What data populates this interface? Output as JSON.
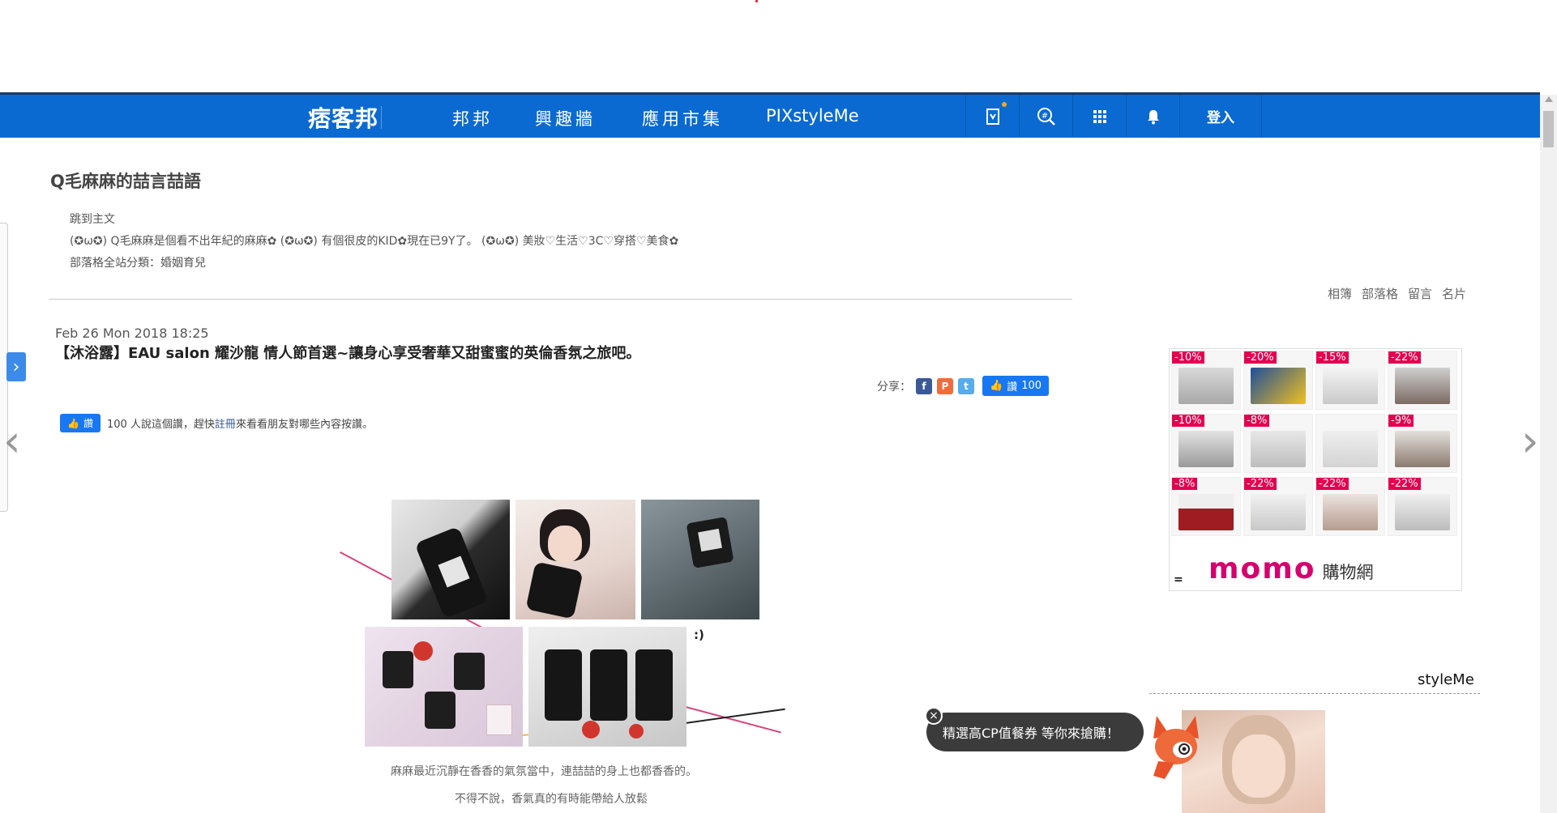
{
  "nav": {
    "logo": "痞客邦",
    "items": [
      "邦邦",
      "興趣牆",
      "應用市集",
      "PIXstyleMe"
    ],
    "login": "登入",
    "icons": [
      "bookmark-icon",
      "search-hash-icon",
      "apps-grid-icon",
      "bell-icon"
    ]
  },
  "blog": {
    "title": "Q毛麻麻的喆言喆語",
    "skip_link": "跳到主文",
    "description": "(✪ω✪) Q毛麻麻是個看不出年紀的麻麻✿ (✪ω✪) 有個很皮的KID✿現在已9Y了。 (✪ω✪) 美妝♡生活♡3C♡穿搭♡美食✿",
    "category": "部落格全站分類：婚姻育兒"
  },
  "side_links": [
    "相簿",
    "部落格",
    "留言",
    "名片"
  ],
  "post": {
    "date": "Feb 26 Mon 2018 18:25",
    "title": "【沐浴露】EAU salon 耀沙龍 情人節首選~讓身心享受奢華又甜蜜蜜的英倫香氛之旅吧。",
    "share_label": "分享：",
    "like_label": "讚",
    "like_count": "100",
    "like_text_pre": "100 人說這個讚，趕快",
    "like_text_link": "註冊",
    "like_text_post": "來看看朋友對哪些內容按讚。",
    "collage_smile": ":)",
    "caption_1": "麻麻最近沉靜在香香的氣氛當中，連喆喆的身上也都香香的。",
    "caption_2": "不得不說，香氣真的有時能帶給人放鬆"
  },
  "ad": {
    "discounts": [
      "-10%",
      "-20%",
      "-15%",
      "-22%",
      "-10%",
      "-8%",
      "",
      "-9%",
      "-8%",
      "-22%",
      "-22%",
      "-22%"
    ],
    "brand": "momo",
    "brand_suffix": "購物網",
    "marker": "="
  },
  "styleme": {
    "label": "styleMe"
  },
  "promo": {
    "bubble": "精選高CP值餐券 等你來搶購！",
    "close": "×"
  },
  "colors": {
    "nav_blue": "#0a6ad1",
    "fb_blue": "#1877f2",
    "momo_pink": "#d6006e",
    "discount_red": "#e4004f"
  }
}
